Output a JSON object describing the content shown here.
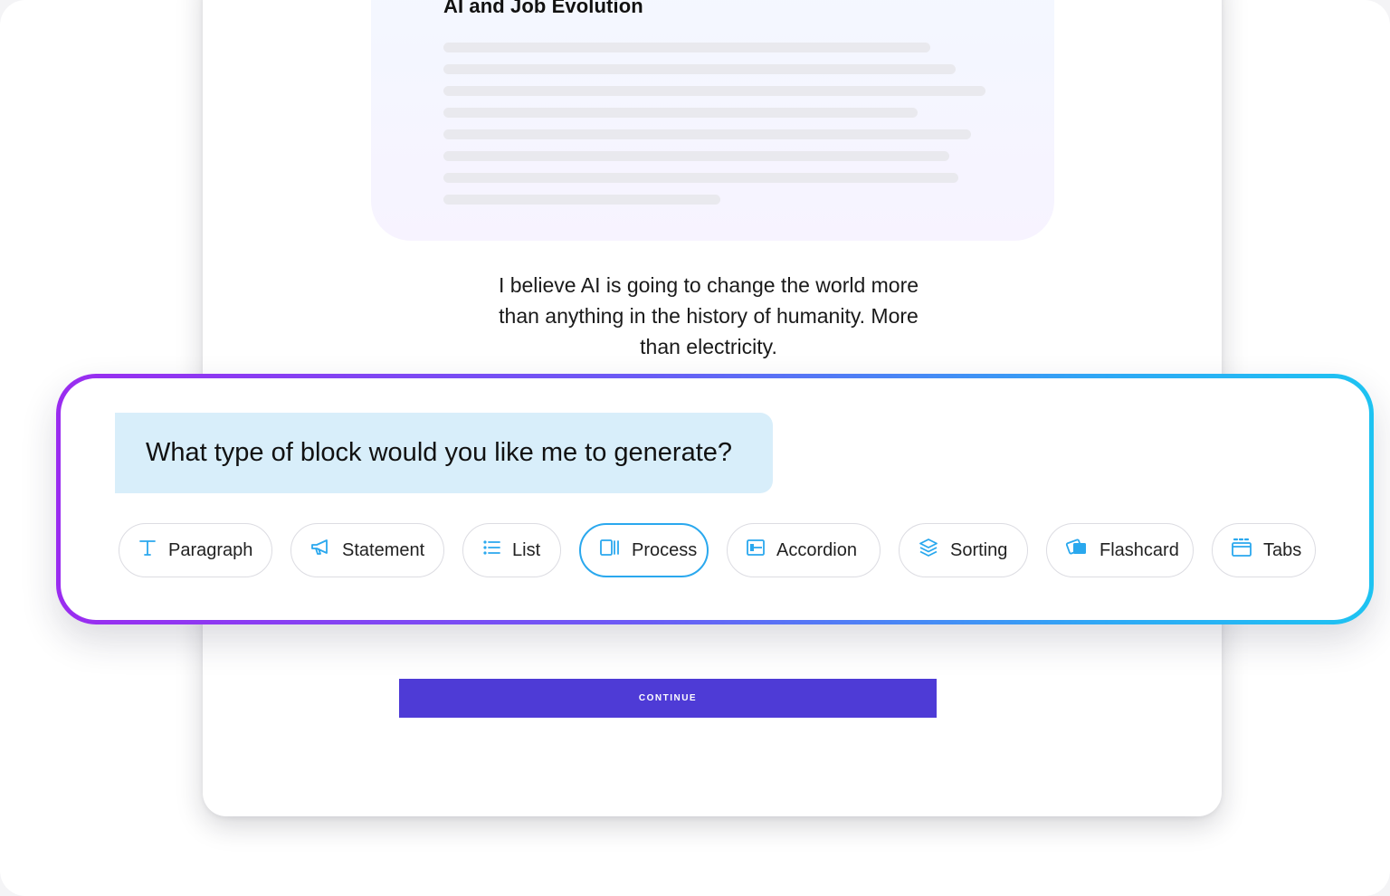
{
  "document": {
    "title": "AI and Job Evolution",
    "quote": "I believe AI is going to change the world more than anything in the history of humanity. More than electricity."
  },
  "ai_panel": {
    "prompt": "What type of block would you like me to generate?",
    "selected": "Process",
    "accent_color": "#2aa8ee",
    "chips": [
      {
        "label": "Paragraph",
        "icon": "text-t-icon"
      },
      {
        "label": "Statement",
        "icon": "megaphone-icon"
      },
      {
        "label": "List",
        "icon": "list-icon"
      },
      {
        "label": "Process",
        "icon": "process-icon"
      },
      {
        "label": "Accordion",
        "icon": "accordion-icon"
      },
      {
        "label": "Sorting",
        "icon": "layers-icon"
      },
      {
        "label": "Flashcard",
        "icon": "flashcard-icon"
      },
      {
        "label": "Tabs",
        "icon": "tabs-icon"
      }
    ]
  },
  "continue_button": {
    "label": "CONTINUE",
    "color": "#4e3bd6"
  }
}
